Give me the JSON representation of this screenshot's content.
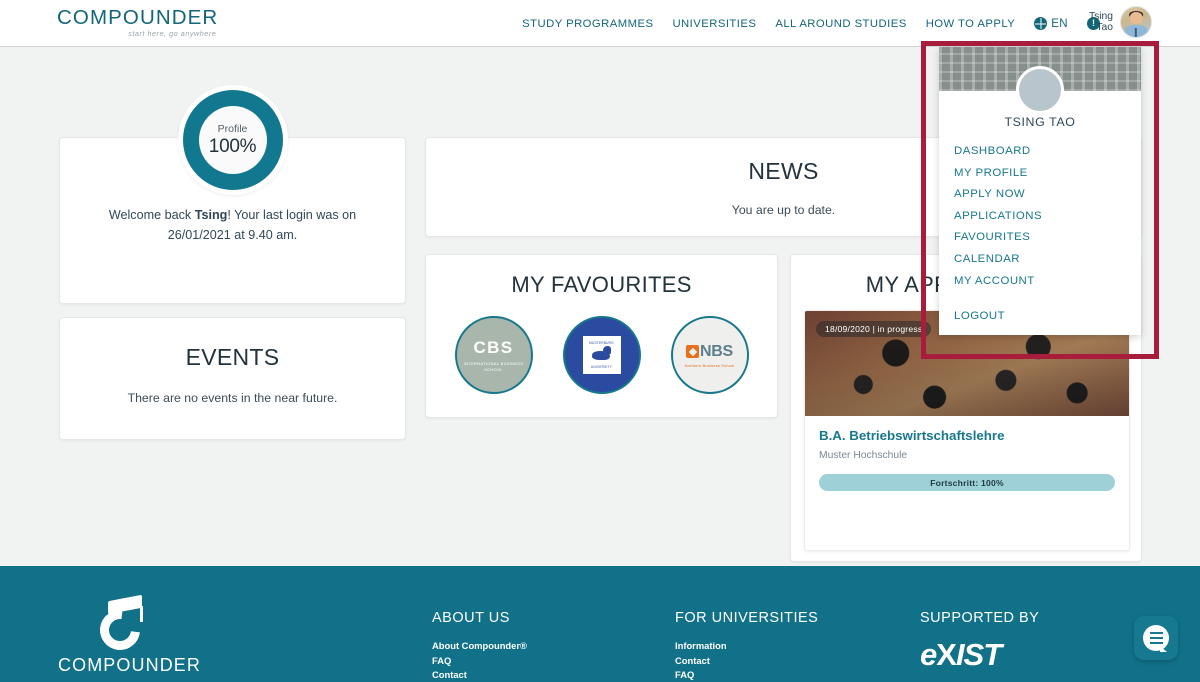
{
  "brand": {
    "name": "COMPOUNDER",
    "tagline": "start here, go anywhere"
  },
  "header": {
    "nav": [
      {
        "label": "STUDY PROGRAMMES"
      },
      {
        "label": "UNIVERSITIES"
      },
      {
        "label": "ALL AROUND STUDIES"
      },
      {
        "label": "HOW TO APPLY"
      }
    ],
    "language": "EN",
    "user_first": "Tsing",
    "user_last": "Tao"
  },
  "dropdown": {
    "user_name": "TSING TAO",
    "items": [
      {
        "label": "DASHBOARD"
      },
      {
        "label": "MY PROFILE"
      },
      {
        "label": "APPLY NOW"
      },
      {
        "label": "APPLICATIONS"
      },
      {
        "label": "FAVOURITES"
      },
      {
        "label": "CALENDAR"
      },
      {
        "label": "MY ACCOUNT"
      }
    ],
    "logout": "LOGOUT"
  },
  "profile": {
    "ring_label": "Profile",
    "ring_value": "100%",
    "welcome_prefix": "Welcome back ",
    "welcome_name": "Tsing",
    "welcome_suffix": "! Your last login was on 26/01/2021 at 9.40 am."
  },
  "events": {
    "title": "EVENTS",
    "empty": "There are no events in the near future."
  },
  "news": {
    "title": "NEWS",
    "empty": "You are up to date."
  },
  "favourites": {
    "title": "MY FAVOURITES",
    "items": [
      {
        "name": "CBS",
        "main": "CBS",
        "sub": "INTERNATIONAL BUSINESS SCHOOL"
      },
      {
        "name": "University Seal",
        "top": "MUSTERBURG",
        "bottom": "UNIVERSITY"
      },
      {
        "name": "NBS",
        "main": "NBS",
        "sub": "Northern Business School"
      }
    ]
  },
  "applications": {
    "title": "MY APPLICATIONS",
    "items": [
      {
        "badge": "18/09/2020 | in progress",
        "title": "B.A. Betriebswirtschaftslehre",
        "school": "Muster Hochschule",
        "progress": "Fortschritt: 100%"
      }
    ]
  },
  "footer": {
    "brand": "COMPOUNDER",
    "columns": [
      {
        "heading": "ABOUT US",
        "links": [
          {
            "label": "About Compounder®"
          },
          {
            "label": "FAQ"
          },
          {
            "label": "Contact"
          }
        ]
      },
      {
        "heading": "FOR UNIVERSITIES",
        "links": [
          {
            "label": "Information"
          },
          {
            "label": "Contact"
          },
          {
            "label": "FAQ"
          }
        ]
      }
    ],
    "supported": {
      "heading": "SUPPORTED BY",
      "logo_a": "e",
      "logo_b": "X",
      "logo_c": "IST"
    }
  },
  "colors": {
    "brand_teal": "#12667a",
    "accent_teal": "#17788d",
    "footer_bg": "#107188",
    "annotation_red": "#a81c3c",
    "progress_fill": "#9ed0d8"
  }
}
